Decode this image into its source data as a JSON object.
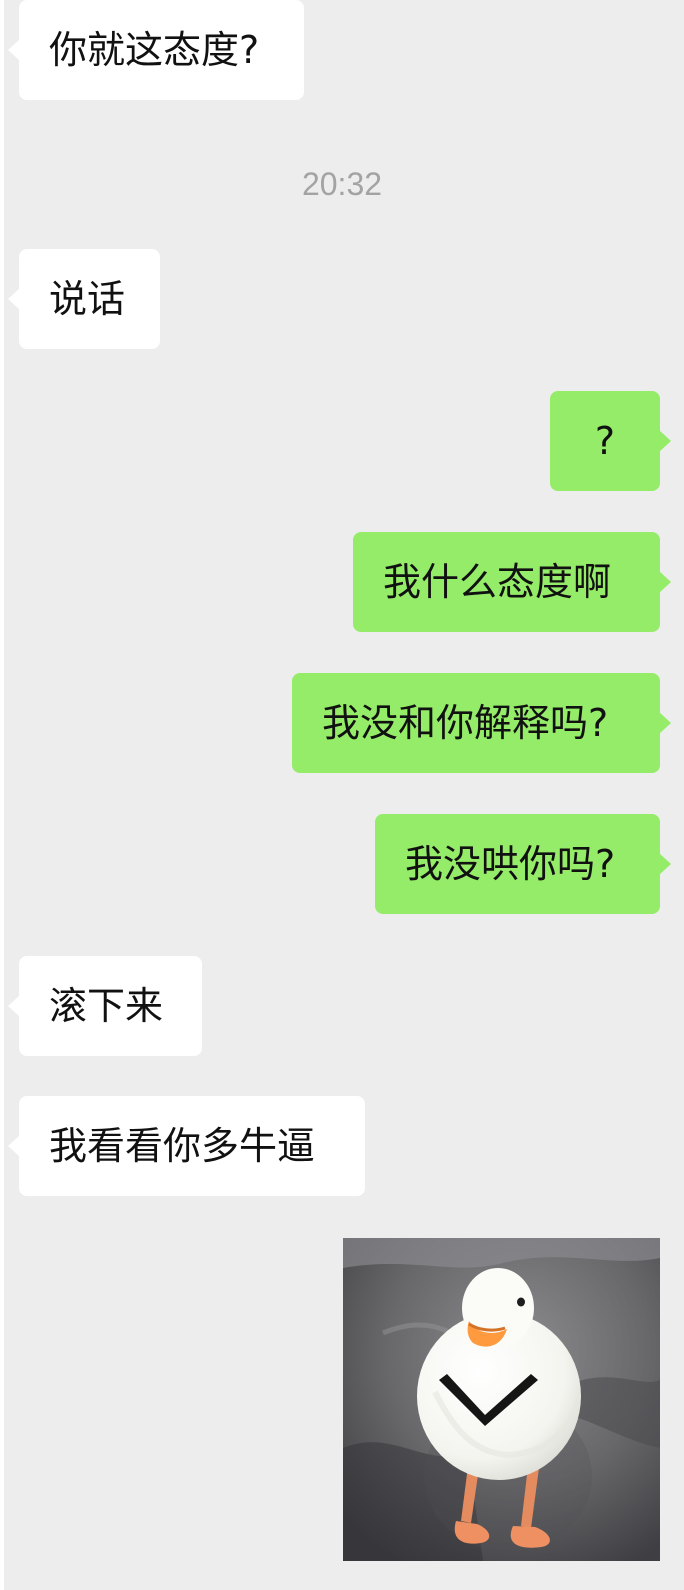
{
  "timestamp": "20:32",
  "messages": [
    {
      "side": "incoming",
      "text": "你就这态度?"
    },
    {
      "side": "incoming",
      "text": "说话"
    },
    {
      "side": "outgoing",
      "text": "?"
    },
    {
      "side": "outgoing",
      "text": "我什么态度啊"
    },
    {
      "side": "outgoing",
      "text": "我没和你解释吗?"
    },
    {
      "side": "outgoing",
      "text": "我没哄你吗?"
    },
    {
      "side": "incoming",
      "text": "滚下来"
    },
    {
      "side": "incoming",
      "text": "我看看你多牛逼"
    }
  ],
  "sticker": {
    "subject": "white-duck-sticker",
    "side": "outgoing"
  },
  "colors": {
    "background": "#ededed",
    "incoming_bubble": "#ffffff",
    "outgoing_bubble": "#95ec69",
    "timestamp": "#a3a3a3",
    "text": "#111111"
  }
}
